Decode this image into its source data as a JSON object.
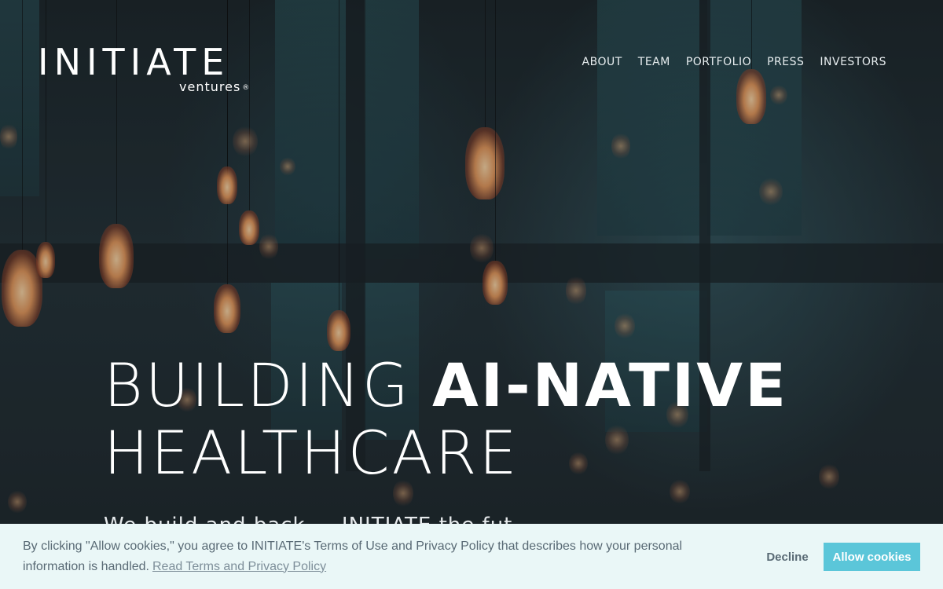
{
  "logo": {
    "wordmark": "INITIATE",
    "subtitle": "ventures",
    "registered": "®"
  },
  "nav": {
    "items": [
      {
        "label": "ABOUT"
      },
      {
        "label": "TEAM"
      },
      {
        "label": "PORTFOLIO"
      },
      {
        "label": "PRESS"
      },
      {
        "label": "INVESTORS"
      }
    ]
  },
  "hero": {
    "line1_light": "BUILDING ",
    "line1_bold": "AI-NATIVE",
    "line2": "HEALTHCARE",
    "tagline": "We build and back ... INITIATE the fut..."
  },
  "cookie_banner": {
    "text": "By clicking \"Allow cookies,\" you agree to INITIATE's Terms of Use and Privacy Policy that describes how your personal information is handled.",
    "link": "Read Terms and Privacy Policy",
    "decline_label": "Decline",
    "allow_label": "Allow cookies"
  },
  "colors": {
    "banner_bg": "#eaf7f7",
    "allow_button": "#5bc6d9",
    "banner_text": "#596a75"
  }
}
